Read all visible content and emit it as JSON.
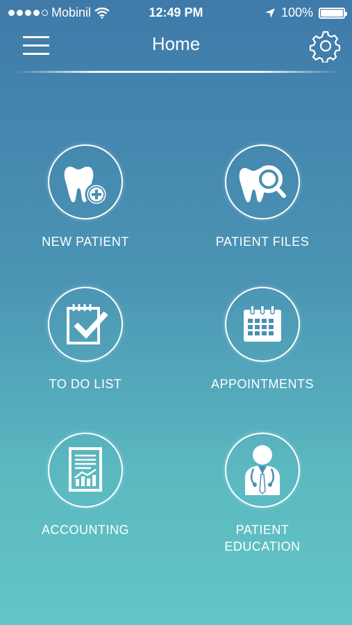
{
  "status_bar": {
    "carrier": "Mobinil",
    "time": "12:49 PM",
    "battery": "100%",
    "battery_level": 1.0
  },
  "header": {
    "title": "Home",
    "menu_icon": "hamburger-menu-icon",
    "settings_icon": "gear-icon"
  },
  "menu": {
    "new_patient": {
      "label": "NEW PATIENT",
      "icon": "tooth-plus-icon"
    },
    "patient_files": {
      "label": "PATIENT FILES",
      "icon": "tooth-magnifier-icon"
    },
    "todo_list": {
      "label": "TO DO LIST",
      "icon": "checklist-icon"
    },
    "appointments": {
      "label": "APPOINTMENTS",
      "icon": "calendar-icon"
    },
    "accounting": {
      "label": "ACCOUNTING",
      "icon": "report-chart-icon"
    },
    "patient_education": {
      "label_line1": "PATIENT",
      "label_line2": "EDUCATION",
      "icon": "doctor-icon"
    }
  }
}
